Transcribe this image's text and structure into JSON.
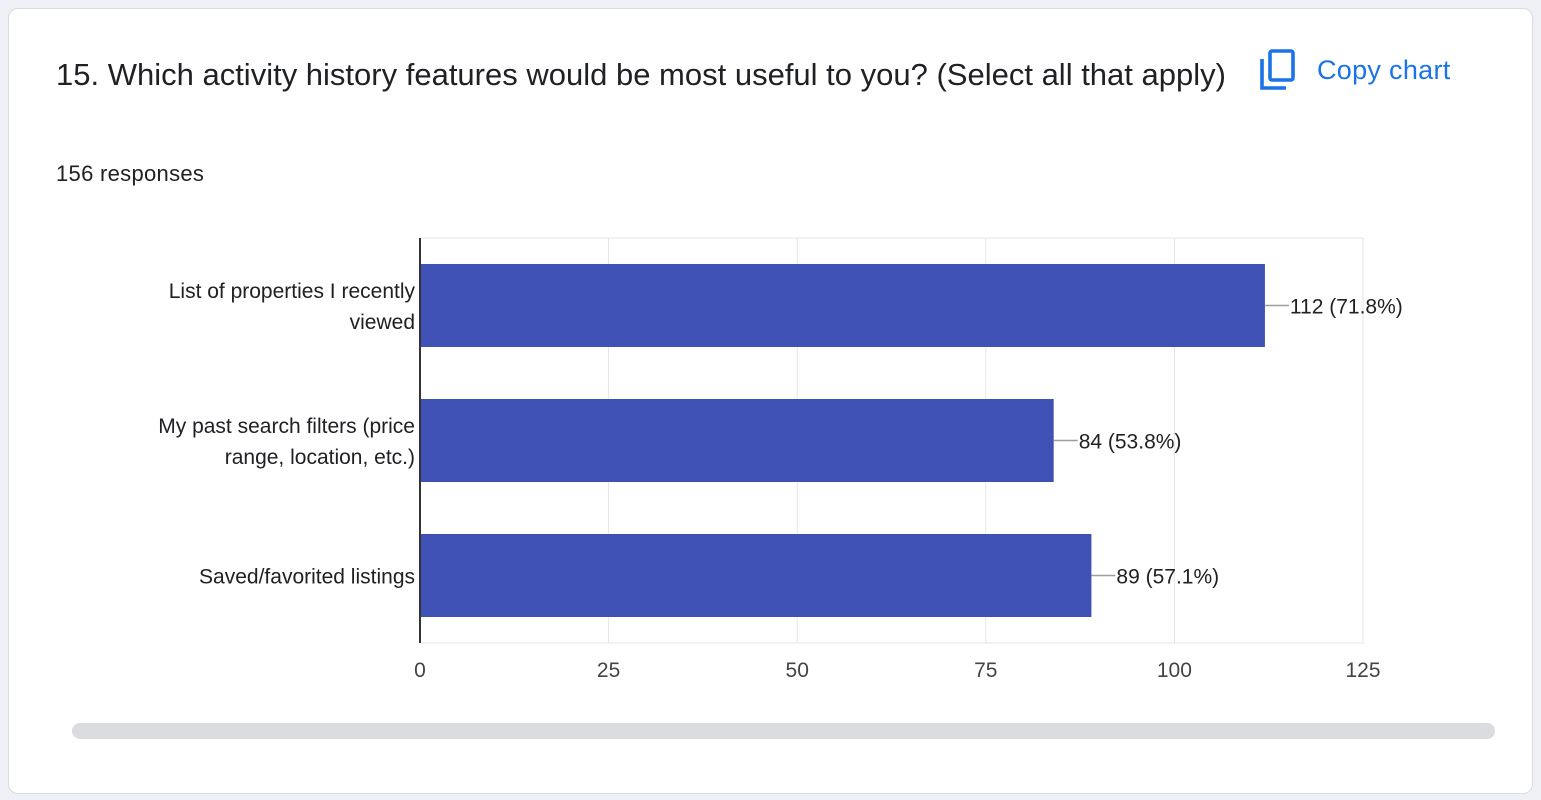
{
  "question": {
    "title": "15. Which activity history features would be most useful to you? (Select all that apply)",
    "responses": "156 responses"
  },
  "toolbar": {
    "copy_label": "Copy chart",
    "copy_icon": "copy-icon"
  },
  "colors": {
    "bar": "#3f51b5",
    "accent": "#1a73e8",
    "text": "#202124"
  },
  "chart_data": {
    "type": "bar",
    "orientation": "horizontal",
    "categories": [
      [
        "List of properties I recently",
        "viewed"
      ],
      [
        "My past search filters (price",
        "range, location, etc.)"
      ],
      [
        "Saved/favorited listings"
      ]
    ],
    "values": [
      112,
      84,
      89
    ],
    "value_labels": [
      "112 (71.8%)",
      "84 (53.8%)",
      "89 (57.1%)"
    ],
    "xticks": [
      0,
      25,
      50,
      75,
      100,
      125
    ],
    "xlim": [
      0,
      125
    ],
    "grid": true
  }
}
